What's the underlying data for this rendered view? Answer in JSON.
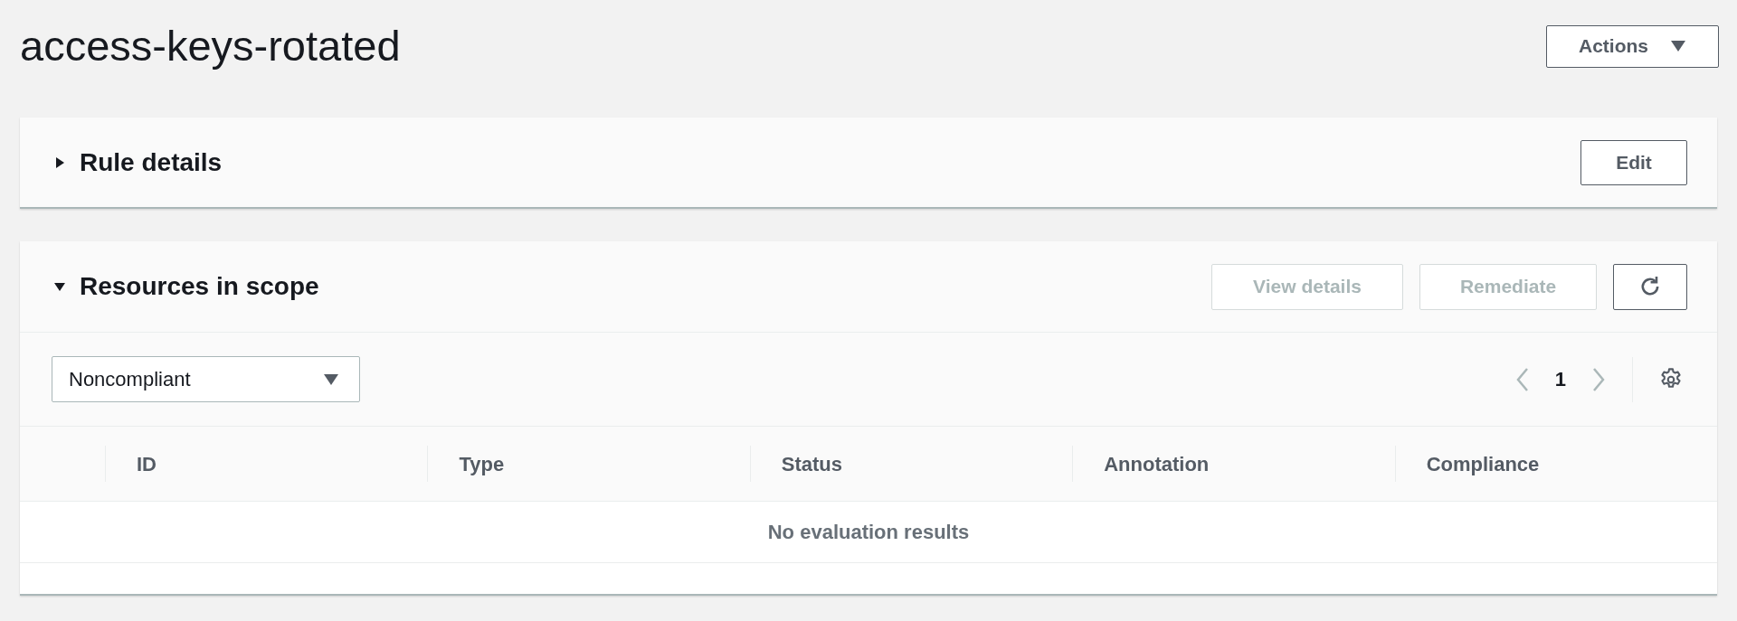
{
  "page_title": "access-keys-rotated",
  "actions_button": {
    "label": "Actions"
  },
  "rule_details": {
    "title": "Rule details",
    "expanded": false,
    "edit_button": "Edit"
  },
  "resources": {
    "title": "Resources in scope",
    "expanded": true,
    "buttons": [
      {
        "label": "View details",
        "disabled": true
      },
      {
        "label": "Remediate",
        "disabled": true
      }
    ],
    "filter": {
      "value": "Noncompliant"
    },
    "pagination": {
      "page": "1",
      "prev_disabled": true,
      "next_disabled": true
    },
    "table": {
      "columns": [
        "ID",
        "Type",
        "Status",
        "Annotation",
        "Compliance"
      ],
      "empty_message": "No evaluation results"
    }
  }
}
